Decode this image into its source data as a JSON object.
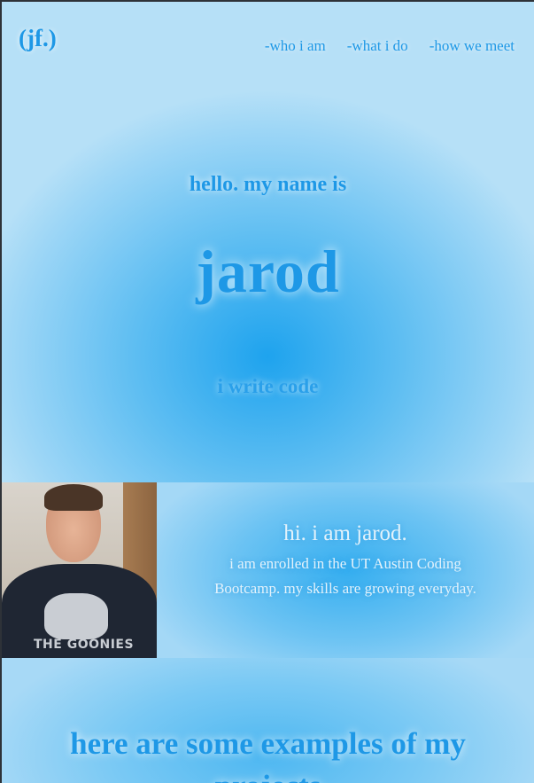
{
  "header": {
    "logo": "(jf.)",
    "nav": [
      {
        "label": "-who i am"
      },
      {
        "label": "-what i do"
      },
      {
        "label": "-how we meet"
      }
    ]
  },
  "hero": {
    "greeting": "hello. my name is",
    "name": "jarod",
    "tagline": "i write code"
  },
  "about": {
    "title": "hi. i am jarod.",
    "body": "i am enrolled in the UT Austin Coding Bootcamp. my skills are growing everyday.",
    "photo_shirt_text": "THE GOONIES"
  },
  "projects": {
    "title": "here are some examples of my projects"
  },
  "colors": {
    "accent": "#1e98e6",
    "hero_center": "#1ea3ee",
    "hero_edge": "#b6e0f7",
    "about_text": "#e3f2fb"
  }
}
